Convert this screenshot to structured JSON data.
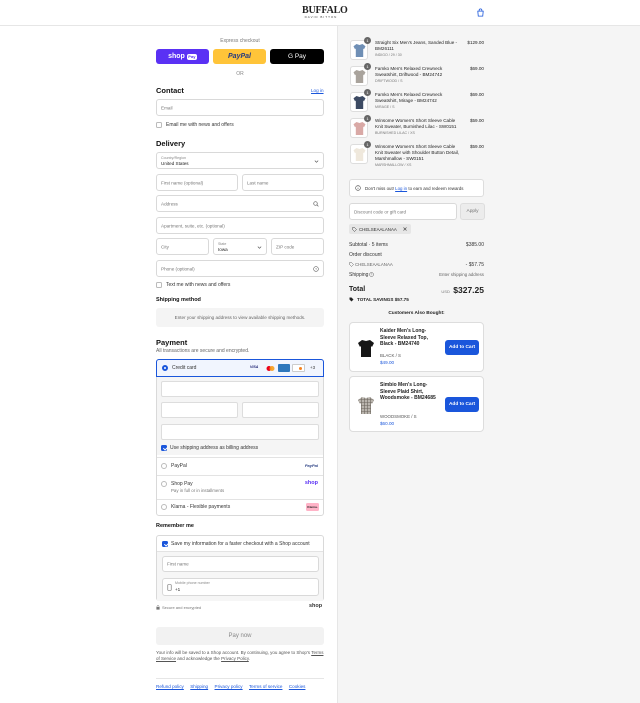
{
  "store": {
    "logo_text": "BUFFALO",
    "logo_sub": "DAVID BITTON"
  },
  "express": {
    "label": "Express checkout",
    "shop_pay": "shop",
    "shop_pay_badge": "Pay",
    "paypal": "PayPal",
    "gpay": "G Pay",
    "or": "OR"
  },
  "contact": {
    "title": "Contact",
    "login": "Log in",
    "email_placeholder": "Email",
    "news_label": "Email me with news and offers"
  },
  "delivery": {
    "title": "Delivery",
    "country_label": "Country/Region",
    "country_value": "United States",
    "first_name": "First name (optional)",
    "last_name": "Last name",
    "address": "Address",
    "apartment": "Apartment, suite, etc. (optional)",
    "city": "City",
    "state_label": "State",
    "state_value": "Iowa",
    "zip": "ZIP code",
    "phone": "Phone (optional)",
    "text_label": "Text me with news and offers"
  },
  "shipping": {
    "title": "Shipping method",
    "message": "Enter your shipping address to view available shipping methods."
  },
  "payment": {
    "title": "Payment",
    "subtitle": "All transactions are secure and encrypted.",
    "credit_card": "Credit card",
    "more_cards": "+3",
    "billing_label": "Use shipping address as billing address",
    "paypal": "PayPal",
    "paypal_logo": "PayPal",
    "shop_pay": "Shop Pay",
    "shop_pay_sub": "Pay in full or in installments",
    "shop_logo": "shop",
    "klarna": "Klarna - Flexible payments",
    "klarna_logo": "Klarna."
  },
  "remember": {
    "title": "Remember me",
    "save_label": "Save my information for a faster checkout with a Shop account",
    "first_name": "First name",
    "mobile_label": "Mobile phone number",
    "mobile_value": "+1",
    "secure": "Secure and encrypted",
    "shop_logo": "shop"
  },
  "pay_now": "Pay now",
  "legal": {
    "text1": "Your info will be saved to a Shop account. By continuing, you agree to Shop's",
    "tos": "Terms of Service",
    "text2": "and acknowledge the",
    "privacy": "Privacy Policy",
    "end": "."
  },
  "footer_links": [
    "Refund policy",
    "Shipping",
    "Privacy policy",
    "Terms of service",
    "Cookies"
  ],
  "cart": {
    "items": [
      {
        "qty": "1",
        "name": "Straight Six Men's Jeans, Sanded Blue - BM26111",
        "variant": "INDIGO / 29 / 30",
        "price": "$129.00",
        "color": "#6f8fb5"
      },
      {
        "qty": "1",
        "name": "Famko Men's Relaxed Crewneck Sweatshirt, Driftwood - BM24742",
        "variant": "DRIFTWOOD / S",
        "price": "$69.00",
        "color": "#a9a39c"
      },
      {
        "qty": "1",
        "name": "Famko Men's Relaxed Crewneck Sweatshirt, Mirage - BM24742",
        "variant": "MIRAGE / S",
        "price": "$69.00",
        "color": "#3c4a63"
      },
      {
        "qty": "1",
        "name": "Winsome Women's Short Sleeve Cable Knit Sweater, Burnished Lilac - SW0151",
        "variant": "BURNISHED LILAC / XS",
        "price": "$59.00",
        "color": "#d9a9a6"
      },
      {
        "qty": "1",
        "name": "Winsome Women's Short Sleeve Cable Knit Sweater with Shoulder Button Detail, Marshmallow - SW0151",
        "variant": "MARSHMALLOW / XS",
        "price": "$59.00",
        "color": "#efe8dc"
      }
    ],
    "rewards_text": "Don't miss out!",
    "rewards_link": "Log in",
    "rewards_end": "to earn and redeem rewards",
    "discount_placeholder": "Discount code or gift card",
    "apply": "Apply",
    "code_chip": "CHELSEAALANAA",
    "subtotal_label": "Subtotal · 5 items",
    "subtotal": "$385.00",
    "order_discount": "Order discount",
    "discount_code": "CHELSEAALANAA",
    "discount_amount": "- $57.75",
    "shipping_label": "Shipping",
    "shipping_value": "Enter shipping address",
    "total_label": "Total",
    "currency": "USD",
    "total": "$327.25",
    "savings_label": "TOTAL SAVINGS",
    "savings": "$57.75"
  },
  "upsell": {
    "title": "Customers Also Bought:",
    "items": [
      {
        "name": "Kaider Men's Long-Sleeve Relaxed Top, Black - BM24740",
        "variant": "BLACK / S",
        "price": "$49.00",
        "button": "Add to Cart"
      },
      {
        "name": "Simbio Men's Long-Sleeve Plaid Shirt, Woodsmoke - BM24685",
        "variant": "WOODSMOKE / S",
        "price": "$60.00",
        "button": "Add to Cart"
      }
    ]
  },
  "colors": {
    "accent": "#1a56db",
    "shop_purple": "#5a31f4",
    "paypal_yellow": "#ffc439"
  }
}
